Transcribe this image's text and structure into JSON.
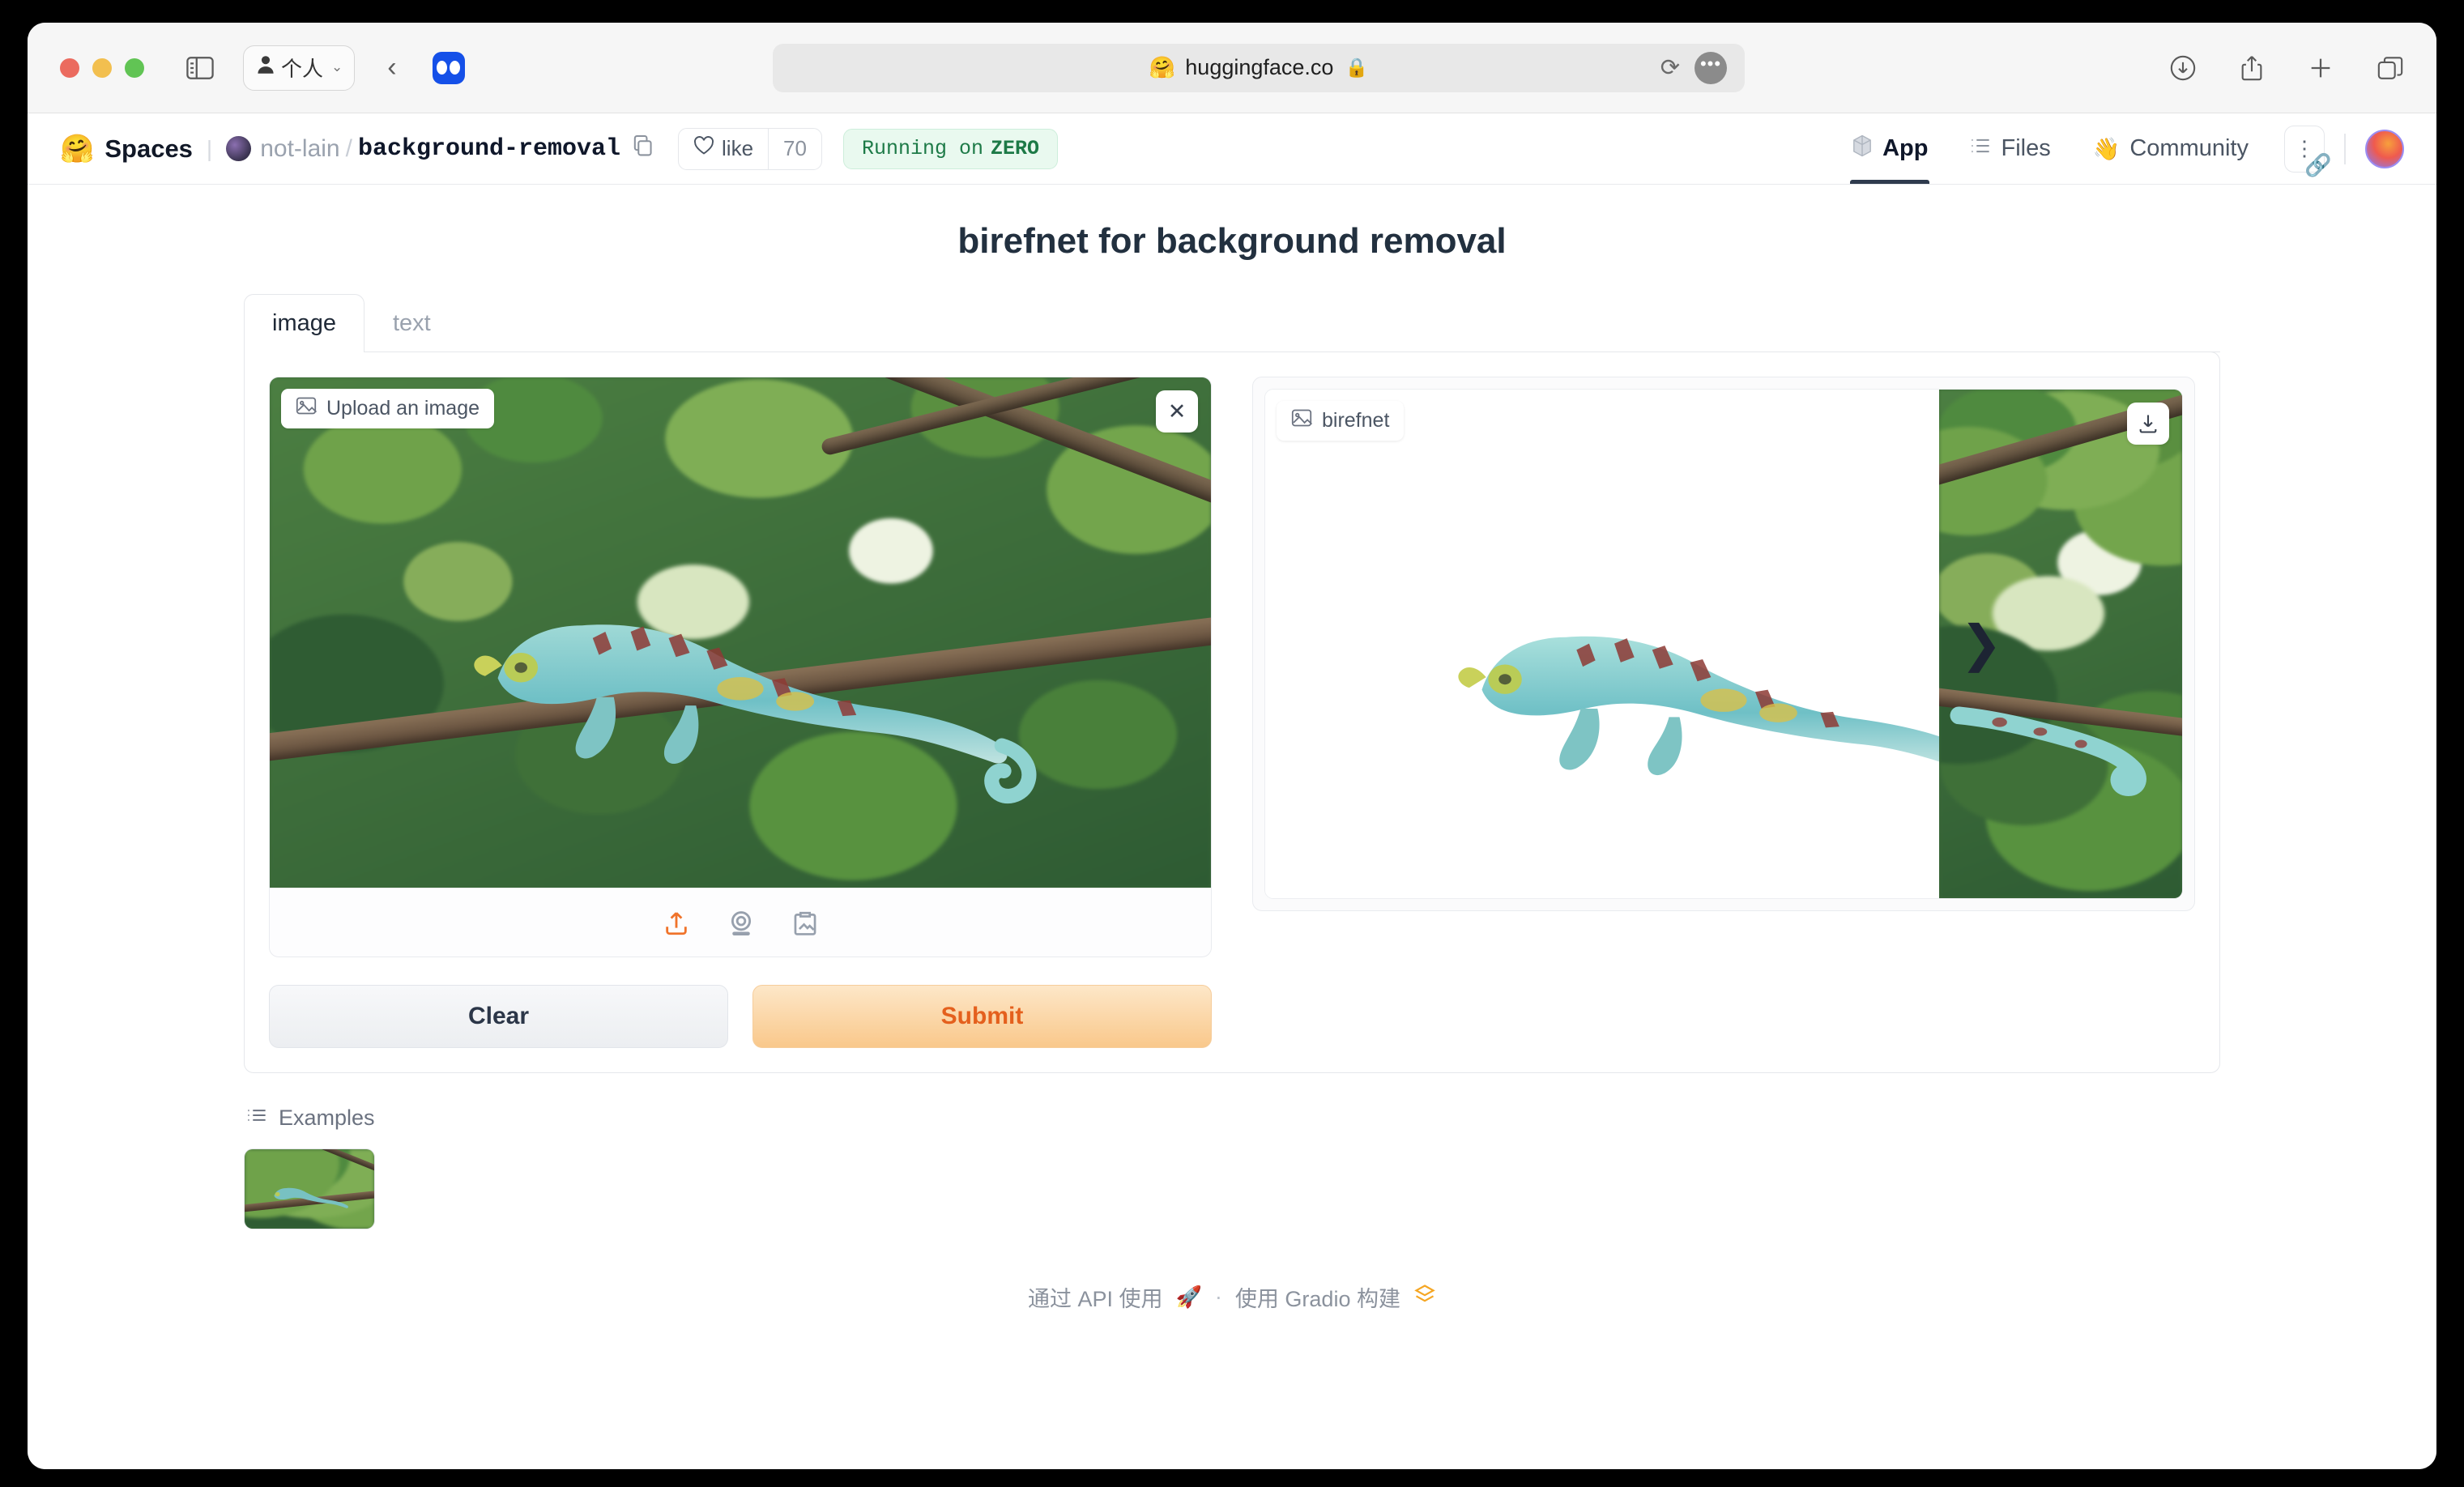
{
  "browser": {
    "profile_label": "个人",
    "profile_icon": "person-icon",
    "sidebar_icon": "sidebar-toggle-icon",
    "back_icon": "back-chevron-icon",
    "favicon_icon": "site-favicon-icon",
    "url": "huggingface.co",
    "url_prefix_emoji": "🤗",
    "lock_icon": "lock-icon",
    "reload_icon": "reload-icon",
    "more_icon": "more-options-icon",
    "right_icons": [
      "downloads-icon",
      "share-icon",
      "new-tab-icon",
      "tab-overview-icon"
    ]
  },
  "hf_header": {
    "logo_emoji": "🤗",
    "spaces_label": "Spaces",
    "owner": "not-lain",
    "slash": "/",
    "repo": "background-removal",
    "copy_icon": "copy-icon",
    "like_label": "like",
    "like_icon": "heart-icon",
    "like_count": "70",
    "status_prefix": "Running on",
    "status_hardware": "ZERO",
    "nav": [
      {
        "label": "App",
        "icon": "cube-icon",
        "active": true
      },
      {
        "label": "Files",
        "icon": "files-icon",
        "active": false
      },
      {
        "label": "Community",
        "icon": "wave-hand-icon",
        "active": false
      }
    ],
    "kebab_icon": "kebab-menu-icon",
    "link_icon": "link-icon",
    "avatar": "user-avatar"
  },
  "app": {
    "title": "birefnet for background removal",
    "tabs": [
      {
        "label": "image",
        "active": true
      },
      {
        "label": "text",
        "active": false
      }
    ],
    "input": {
      "badge_label": "Upload an image",
      "badge_icon": "image-placeholder-icon",
      "clear_icon": "close-icon",
      "tools": [
        {
          "name": "upload-icon",
          "glyph": "⤒",
          "accent": "#f0732a"
        },
        {
          "name": "webcam-icon",
          "glyph": "◉",
          "accent": "#97a0ad"
        },
        {
          "name": "paste-clipboard-icon",
          "glyph": "📋",
          "accent": "#97a0ad"
        }
      ]
    },
    "output": {
      "badge_label": "birefnet",
      "badge_icon": "image-placeholder-icon",
      "download_icon": "download-icon",
      "slider_left_icon": "chevron-left-icon",
      "slider_right_icon": "chevron-right-icon"
    },
    "buttons": {
      "clear": "Clear",
      "submit": "Submit"
    },
    "examples": {
      "label": "Examples",
      "icon": "list-icon",
      "items": [
        {
          "name": "chameleon-example-thumbnail"
        }
      ]
    },
    "footer": {
      "api_label": "通过 API 使用",
      "api_icon": "rocket-icon",
      "separator": "·",
      "built_label": "使用 Gradio 构建",
      "built_icon": "gradio-logo-icon"
    }
  },
  "colors": {
    "accent_orange": "#f0732a",
    "submit_text": "#e4601d",
    "status_green": "#1d7a47",
    "title_ink": "#22303f"
  }
}
